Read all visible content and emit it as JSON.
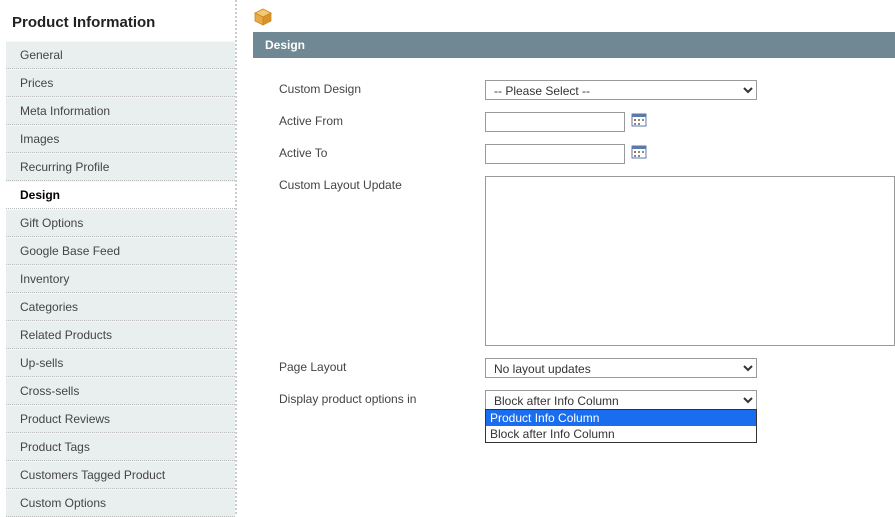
{
  "sidebar": {
    "title": "Product Information",
    "items": [
      {
        "label": "General"
      },
      {
        "label": "Prices"
      },
      {
        "label": "Meta Information"
      },
      {
        "label": "Images"
      },
      {
        "label": "Recurring Profile"
      },
      {
        "label": "Design"
      },
      {
        "label": "Gift Options"
      },
      {
        "label": "Google Base Feed"
      },
      {
        "label": "Inventory"
      },
      {
        "label": "Categories"
      },
      {
        "label": "Related Products"
      },
      {
        "label": "Up-sells"
      },
      {
        "label": "Cross-sells"
      },
      {
        "label": "Product Reviews"
      },
      {
        "label": "Product Tags"
      },
      {
        "label": "Customers Tagged Product"
      },
      {
        "label": "Custom Options"
      }
    ],
    "active_index": 5
  },
  "panel": {
    "title": "Design"
  },
  "fields": {
    "custom_design": {
      "label": "Custom Design",
      "value": "-- Please Select --"
    },
    "active_from": {
      "label": "Active From",
      "value": ""
    },
    "active_to": {
      "label": "Active To",
      "value": ""
    },
    "custom_layout_update": {
      "label": "Custom Layout Update",
      "value": ""
    },
    "page_layout": {
      "label": "Page Layout",
      "value": "No layout updates"
    },
    "display_options": {
      "label": "Display product options in",
      "value": "Block after Info Column",
      "options": [
        "Product Info Column",
        "Block after Info Column"
      ],
      "hover_index": 0
    }
  }
}
